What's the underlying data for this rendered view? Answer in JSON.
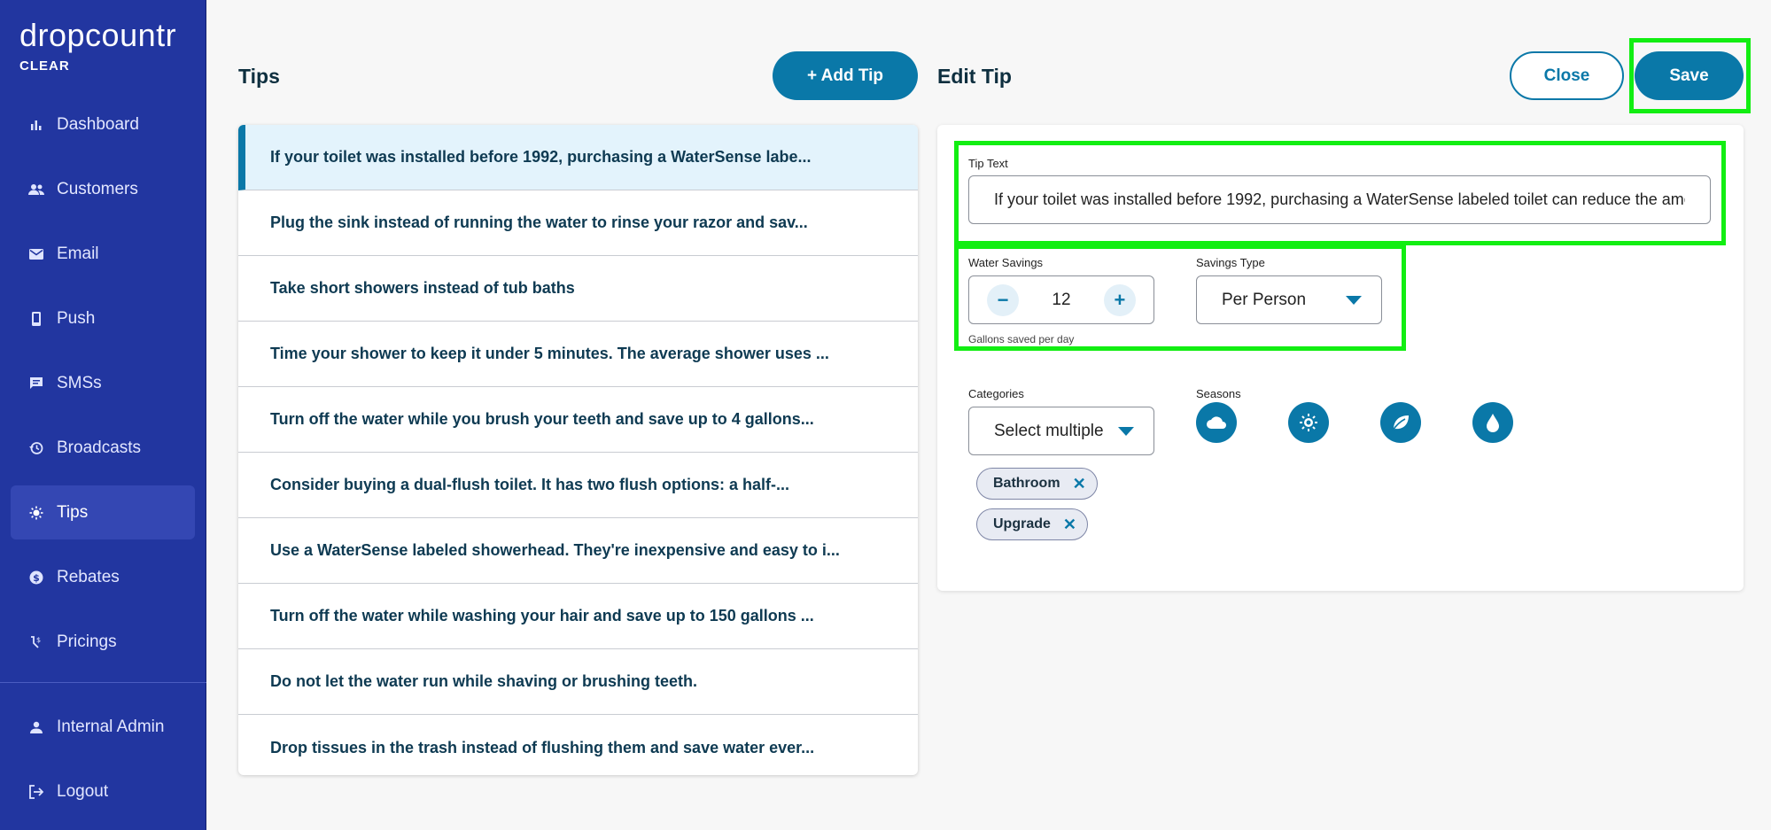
{
  "brand": {
    "name": "dropcountr",
    "sub": "CLEAR"
  },
  "nav": {
    "items": [
      {
        "label": "Dashboard",
        "icon": "bar-chart-icon"
      },
      {
        "label": "Customers",
        "icon": "people-icon"
      },
      {
        "label": "Email",
        "icon": "mail-icon"
      },
      {
        "label": "Push",
        "icon": "phone-icon"
      },
      {
        "label": "SMSs",
        "icon": "message-icon"
      },
      {
        "label": "Broadcasts",
        "icon": "history-icon"
      },
      {
        "label": "Tips",
        "icon": "sun-icon"
      },
      {
        "label": "Rebates",
        "icon": "dollar-icon"
      },
      {
        "label": "Pricings",
        "icon": "pricing-icon"
      }
    ],
    "bottom": [
      {
        "label": "Internal Admin",
        "icon": "person-icon"
      },
      {
        "label": "Logout",
        "icon": "logout-icon"
      }
    ]
  },
  "tips": {
    "title": "Tips",
    "add_label": "+ Add Tip",
    "rows": [
      "If your toilet was installed before 1992, purchasing a WaterSense labe...",
      "Plug the sink instead of running the water to rinse your razor and sav...",
      "Take short showers instead of tub baths",
      "Time your shower to keep it under 5 minutes. The average shower uses ...",
      "Turn off the water while you brush your teeth and save up to 4 gallons...",
      "Consider buying a dual-flush toilet. It has two flush options: a half-...",
      "Use a WaterSense labeled showerhead. They're inexpensive and easy to i...",
      "Turn off the water while washing your hair and save up to 150 gallons ...",
      "Do not let the water run while shaving or brushing teeth.",
      "Drop tissues in the trash instead of flushing them and save water ever..."
    ]
  },
  "edit": {
    "title": "Edit Tip",
    "close_label": "Close",
    "save_label": "Save",
    "tip_text_label": "Tip Text",
    "tip_text_value": "If your toilet was installed before 1992, purchasing a WaterSense labeled toilet can reduce the amount of water used per flush",
    "water_savings_label": "Water Savings",
    "water_savings_value": "12",
    "water_savings_helper": "Gallons saved per day",
    "savings_type_label": "Savings Type",
    "savings_type_value": "Per Person",
    "categories_label": "Categories",
    "categories_value": "Select multiple",
    "seasons_label": "Seasons",
    "season_icons": [
      "cloud-icon",
      "sun-icon",
      "leaf-icon",
      "water-drop-icon"
    ],
    "chips": [
      "Bathroom",
      "Upgrade"
    ]
  },
  "colors": {
    "sidebar": "#2236a0",
    "accent": "#0a78a8",
    "highlight": "#12ee12"
  }
}
